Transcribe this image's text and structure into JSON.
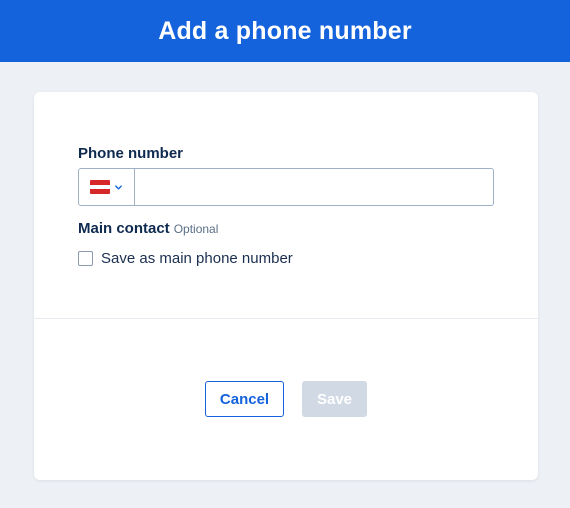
{
  "header": {
    "title": "Add a phone number"
  },
  "form": {
    "phone_label": "Phone number",
    "phone_value": "",
    "country": {
      "flag_icon": "austria-flag-icon",
      "flag_colors": [
        "#d62828",
        "#ffffff",
        "#d62828"
      ]
    },
    "main_contact_label": "Main contact",
    "optional_label": "Optional",
    "checkbox_label": "Save as main phone number",
    "checkbox_checked": false
  },
  "actions": {
    "cancel_label": "Cancel",
    "save_label": "Save"
  },
  "colors": {
    "primary": "#1462dc",
    "disabled": "#d0d9e4",
    "background": "#edf0f4"
  }
}
